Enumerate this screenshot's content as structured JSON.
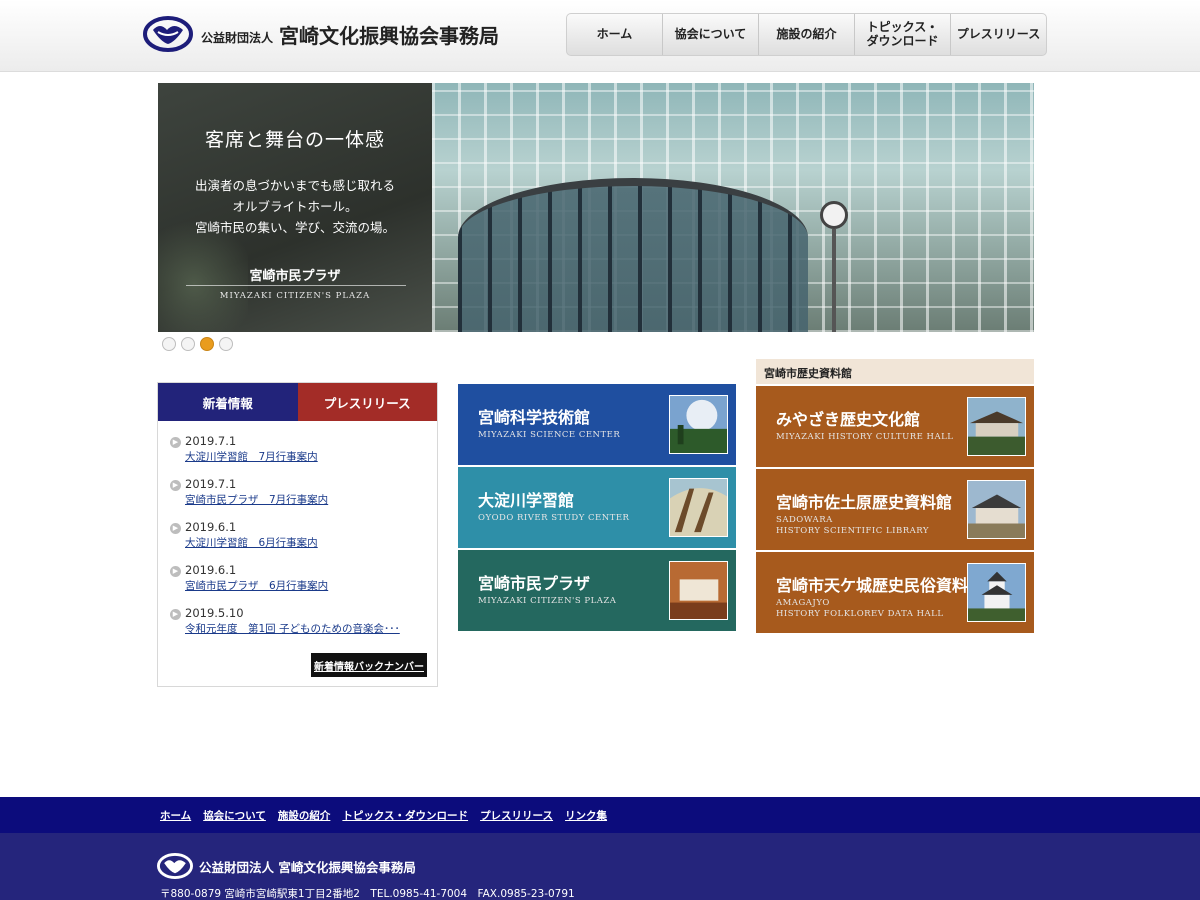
{
  "header": {
    "org_prefix": "公益財団法人",
    "org_name": "宮崎文化振興協会事務局",
    "nav": [
      {
        "label": "ホーム"
      },
      {
        "label": "協会について"
      },
      {
        "label": "施設の紹介"
      },
      {
        "label": "トピックス・\nダウンロード"
      },
      {
        "label": "プレスリリース"
      }
    ]
  },
  "hero": {
    "title": "客席と舞台の一体感",
    "lines": [
      "出演者の息づかいまでも感じ取れる",
      "オルブライトホール。",
      "宮崎市民の集い、学び、交流の場。"
    ],
    "name": "宮崎市民プラザ",
    "name_en": "MIYAZAKI CITIZEN'S PLAZA",
    "slides_total": 4,
    "active_slide": 3
  },
  "news": {
    "tabs": [
      "新着情報",
      "プレスリリース"
    ],
    "active_tab": 0,
    "items": [
      {
        "date": "2019.7.1",
        "title": "大淀川学習館　7月行事案内"
      },
      {
        "date": "2019.7.1",
        "title": "宮崎市民プラザ　7月行事案内"
      },
      {
        "date": "2019.6.1",
        "title": "大淀川学習館　6月行事案内"
      },
      {
        "date": "2019.6.1",
        "title": "宮崎市民プラザ　6月行事案内"
      },
      {
        "date": "2019.5.10",
        "title": "令和元年度　第1回 子どものための音楽会･･･"
      }
    ],
    "more_label": "新着情報バックナンバー"
  },
  "facilities": [
    {
      "title": "宮崎科学技術館",
      "en": "MIYAZAKI SCIENCE CENTER",
      "color": "#1f4fa0"
    },
    {
      "title": "大淀川学習館",
      "en": "OYODO RIVER STUDY CENTER",
      "color": "#2e8fa8"
    },
    {
      "title": "宮崎市民プラザ",
      "en": "MIYAZAKI CITIZEN'S PLAZA",
      "color": "#24685f"
    }
  ],
  "history": {
    "header": "宮崎市歴史資料館",
    "items": [
      {
        "title": "みやざき歴史文化館",
        "en": "MIYAZAKI HISTORY CULTURE HALL",
        "en2": "",
        "color": "#a75a1d"
      },
      {
        "title": "宮崎市佐土原歴史資料館",
        "en": "SADOWARA",
        "en2": "HISTORY SCIENTIFIC LIBRARY",
        "color": "#a75a1d"
      },
      {
        "title": "宮崎市天ケ城歴史民俗資料館",
        "en": "AMAGAJYO",
        "en2": "HISTORY FOLKLOREV DATA HALL",
        "color": "#a75a1d"
      }
    ]
  },
  "footer": {
    "links": [
      "ホーム",
      "協会について",
      "施設の紹介",
      "トピックス・ダウンロード",
      "プレスリリース",
      "リンク集"
    ],
    "org": "公益財団法人 宮崎文化振興協会事務局",
    "address": "〒880-0879 宮崎市宮崎駅東1丁目2番地2　TEL.0985-41-7004　FAX.0985-23-0791"
  },
  "colors": {
    "nav_bg": "#0c0c7c",
    "footer_bg": "#25257c",
    "news_tab_active": "#22237a",
    "news_tab_press": "#a32c27",
    "slide_active": "#e99c1d"
  }
}
